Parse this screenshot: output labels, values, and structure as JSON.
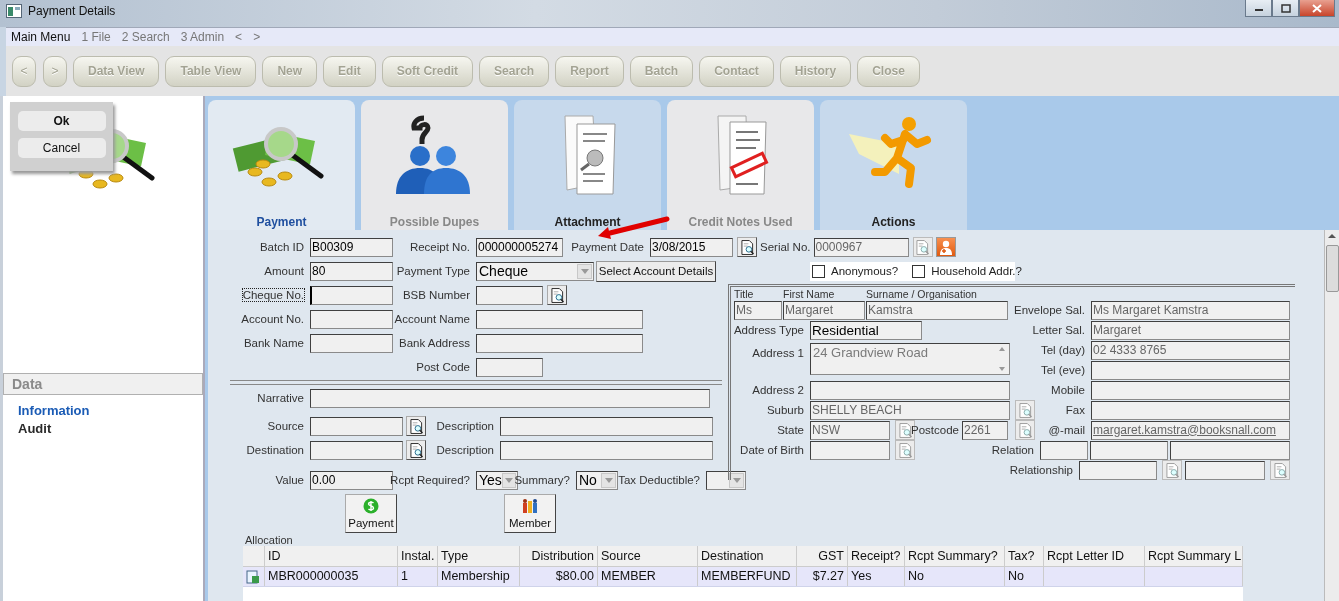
{
  "window": {
    "title": "Payment Details"
  },
  "menu": [
    {
      "label": "Main Menu",
      "disabled": false
    },
    {
      "label": "1 File",
      "disabled": true
    },
    {
      "label": "2 Search",
      "disabled": true
    },
    {
      "label": "3 Admin",
      "disabled": true
    },
    {
      "label": "<",
      "disabled": true
    },
    {
      "label": ">",
      "disabled": true
    }
  ],
  "toolbar": [
    {
      "label": "<",
      "disabled": true
    },
    {
      "label": ">",
      "disabled": true
    },
    {
      "label": "Data View",
      "disabled": true
    },
    {
      "label": "Table View",
      "disabled": true
    },
    {
      "label": "New",
      "disabled": true
    },
    {
      "label": "Edit",
      "disabled": true
    },
    {
      "label": "Soft Credit",
      "disabled": true
    },
    {
      "label": "Search",
      "disabled": true
    },
    {
      "label": "Report",
      "disabled": true
    },
    {
      "label": "Batch",
      "disabled": true
    },
    {
      "label": "Contact",
      "disabled": true
    },
    {
      "label": "History",
      "disabled": true
    },
    {
      "label": "Close",
      "disabled": true
    }
  ],
  "dialog": {
    "buttons": [
      "Ok",
      "Cancel"
    ]
  },
  "sidebar": {
    "section": "Data",
    "items": [
      {
        "label": "Information",
        "selected": true
      },
      {
        "label": "Audit",
        "selected": false
      }
    ]
  },
  "tabs": [
    {
      "label": "Payment",
      "selected": true,
      "disabled": false
    },
    {
      "label": "Possible Dupes",
      "selected": false,
      "disabled": true
    },
    {
      "label": "Attachment",
      "selected": false,
      "disabled": false
    },
    {
      "label": "Credit Notes Used",
      "selected": false,
      "disabled": true
    },
    {
      "label": "Actions",
      "selected": false,
      "disabled": false
    }
  ],
  "payment": {
    "batch_id": {
      "label": "Batch ID",
      "value": "B00309",
      "disabled": false
    },
    "receipt_no": {
      "label": "Receipt No.",
      "value": "000000005274",
      "disabled": false
    },
    "payment_date": {
      "label": "Payment Date",
      "value": "3/08/2015",
      "disabled": false
    },
    "serial_no": {
      "label": "Serial No.",
      "value": "0000967",
      "disabled": true
    },
    "amount": {
      "label": "Amount",
      "value": "80",
      "disabled": false
    },
    "payment_type": {
      "label": "Payment Type",
      "value": "Cheque"
    },
    "select_account": "Select Account Details",
    "anonymous": {
      "label": "Anonymous?",
      "checked": false
    },
    "household": {
      "label": "Household Addr.?",
      "checked": false
    },
    "cheque_no": {
      "label": "Cheque No.",
      "focused": true
    },
    "bsb_number": {
      "label": "BSB Number"
    },
    "account_no": {
      "label": "Account No."
    },
    "account_name": {
      "label": "Account Name"
    },
    "bank_name": {
      "label": "Bank Name"
    },
    "bank_address": {
      "label": "Bank Address"
    },
    "post_code": {
      "label": "Post Code"
    },
    "narrative": {
      "label": "Narrative"
    },
    "source": {
      "label": "Source"
    },
    "source_description": {
      "label": "Description"
    },
    "destination": {
      "label": "Destination"
    },
    "destination_description": {
      "label": "Description"
    },
    "value": {
      "label": "Value",
      "value": "0.00",
      "disabled": false
    },
    "rcpt_required": {
      "label": "Rcpt Required?",
      "value": "Yes"
    },
    "summary": {
      "label": "Summary?",
      "value": "No"
    },
    "tax_deductible": {
      "label": "Tax Deductible?"
    },
    "buttons": [
      "Payment",
      "Member"
    ]
  },
  "contact": {
    "title": {
      "label": "Title",
      "value": "Ms",
      "disabled": true
    },
    "first_name": {
      "label": "First Name",
      "value": "Margaret",
      "disabled": true
    },
    "surname": {
      "label": "Surname / Organisation",
      "value": "Kamstra",
      "disabled": true
    },
    "address_type": {
      "label": "Address Type",
      "value": "Residential",
      "disabled": false
    },
    "address_1": {
      "label": "Address 1",
      "value": "24 Grandview Road",
      "disabled": true
    },
    "address_2": {
      "label": "Address 2"
    },
    "suburb": {
      "label": "Suburb",
      "value": "SHELLY BEACH",
      "disabled": true
    },
    "state": {
      "label": "State",
      "value": "NSW",
      "disabled": true
    },
    "postcode": {
      "label": "Postcode",
      "value": "2261",
      "disabled": true
    },
    "date_of_birth": {
      "label": "Date of Birth"
    },
    "envelope_sal": {
      "label": "Envelope Sal.",
      "value": "Ms Margaret Kamstra",
      "disabled": true
    },
    "letter_sal": {
      "label": "Letter Sal.",
      "value": "Margaret",
      "disabled": true
    },
    "tel_day": {
      "label": "Tel (day)",
      "value": "02 4333 8765",
      "disabled": true
    },
    "tel_eve": {
      "label": "Tel (eve)"
    },
    "mobile": {
      "label": "Mobile"
    },
    "fax": {
      "label": "Fax"
    },
    "email": {
      "label": "@-mail",
      "value": "margaret.kamstra@booksnall.com",
      "disabled": true
    },
    "relation": {
      "label": "Relation"
    },
    "relationship": {
      "label": "Relationship"
    }
  },
  "allocation": {
    "label": "Allocation",
    "columns": [
      "ID",
      "Instal.",
      "Type",
      "Distribution",
      "Source",
      "Destination",
      "GST",
      "Receipt?",
      "Rcpt Summary?",
      "Tax?",
      "Rcpt Letter ID",
      "Rcpt Summary L"
    ],
    "rows": [
      {
        "selected": true,
        "cells": [
          "MBR000000035",
          "1",
          "Membership",
          "$80.00",
          "MEMBER",
          "MEMBERFUND",
          "$7.27",
          "Yes",
          "No",
          "No"
        ]
      }
    ]
  }
}
